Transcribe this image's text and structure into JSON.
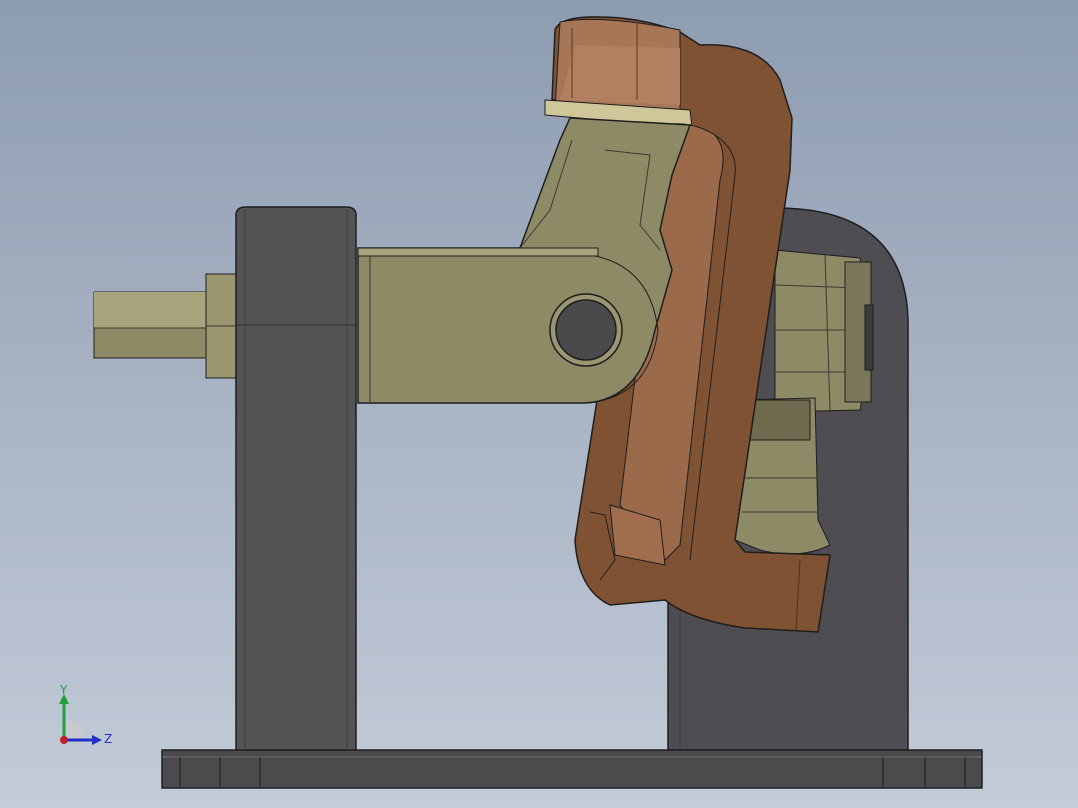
{
  "viewport": {
    "background_top": "#8e9cb1",
    "background_bottom": "#c3ccd8"
  },
  "model": {
    "parts": [
      "base-plate",
      "left-support-bracket",
      "right-support-bracket",
      "input-shaft",
      "yoke-arm",
      "cross-spider",
      "output-fork"
    ],
    "colors": {
      "steel_dark": "#555558",
      "brass": "#8e8a66",
      "copper": "#8a5a3c"
    }
  },
  "triad": {
    "y_label": "Y",
    "z_label": "Z",
    "y_color": "#1fa03a",
    "z_color": "#2330c8",
    "x_color": "#c0202a"
  }
}
